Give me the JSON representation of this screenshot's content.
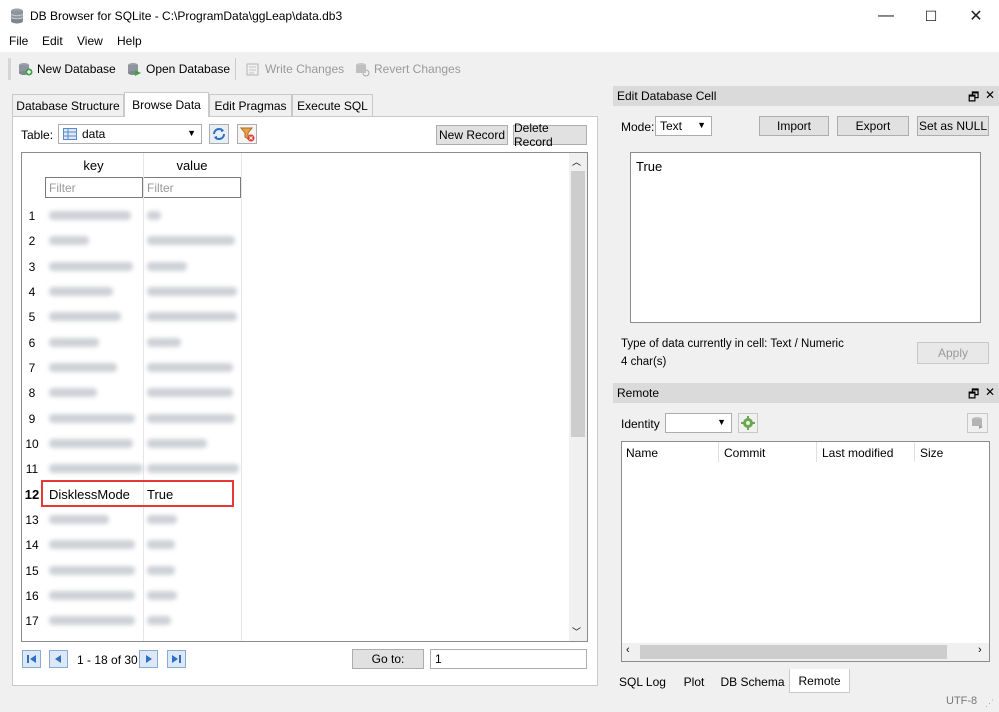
{
  "window": {
    "title": "DB Browser for SQLite - C:\\ProgramData\\ggLeap\\data.db3",
    "minimize": "—",
    "maximize": "☐",
    "close": "✕"
  },
  "menu": [
    "File",
    "Edit",
    "View",
    "Help"
  ],
  "toolbar": {
    "new_database": "New Database",
    "open_database": "Open Database",
    "write_changes": "Write Changes",
    "revert_changes": "Revert Changes"
  },
  "tabs": [
    "Database Structure",
    "Browse Data",
    "Edit Pragmas",
    "Execute SQL"
  ],
  "browse": {
    "table_label": "Table:",
    "table_value": "data",
    "new_record": "New Record",
    "delete_record": "Delete Record",
    "columns": [
      "key",
      "value"
    ],
    "filter_placeholder": "Filter",
    "row_numbers": [
      "1",
      "2",
      "3",
      "4",
      "5",
      "6",
      "7",
      "8",
      "9",
      "10",
      "11",
      "12",
      "13",
      "14",
      "15",
      "16",
      "17"
    ],
    "highlighted_row": {
      "num": "12",
      "key": "DisklessMode",
      "value": "True"
    },
    "pager": "1 - 18 of 30",
    "goto_label": "Go to:",
    "goto_value": "1"
  },
  "edit_cell": {
    "title": "Edit Database Cell",
    "mode_label": "Mode:",
    "mode_value": "Text",
    "import": "Import",
    "export": "Export",
    "set_null": "Set as NULL",
    "content": "True",
    "type_info": "Type of data currently in cell: Text / Numeric",
    "size_info": "4 char(s)",
    "apply": "Apply"
  },
  "remote": {
    "title": "Remote",
    "identity_label": "Identity",
    "columns": [
      "Name",
      "Commit",
      "Last modified",
      "Size"
    ]
  },
  "bottom_tabs": [
    "SQL Log",
    "Plot",
    "DB Schema",
    "Remote"
  ],
  "status": {
    "encoding": "UTF-8"
  },
  "colors": {
    "highlight_border": "#e53935",
    "selection": "#dadada"
  }
}
